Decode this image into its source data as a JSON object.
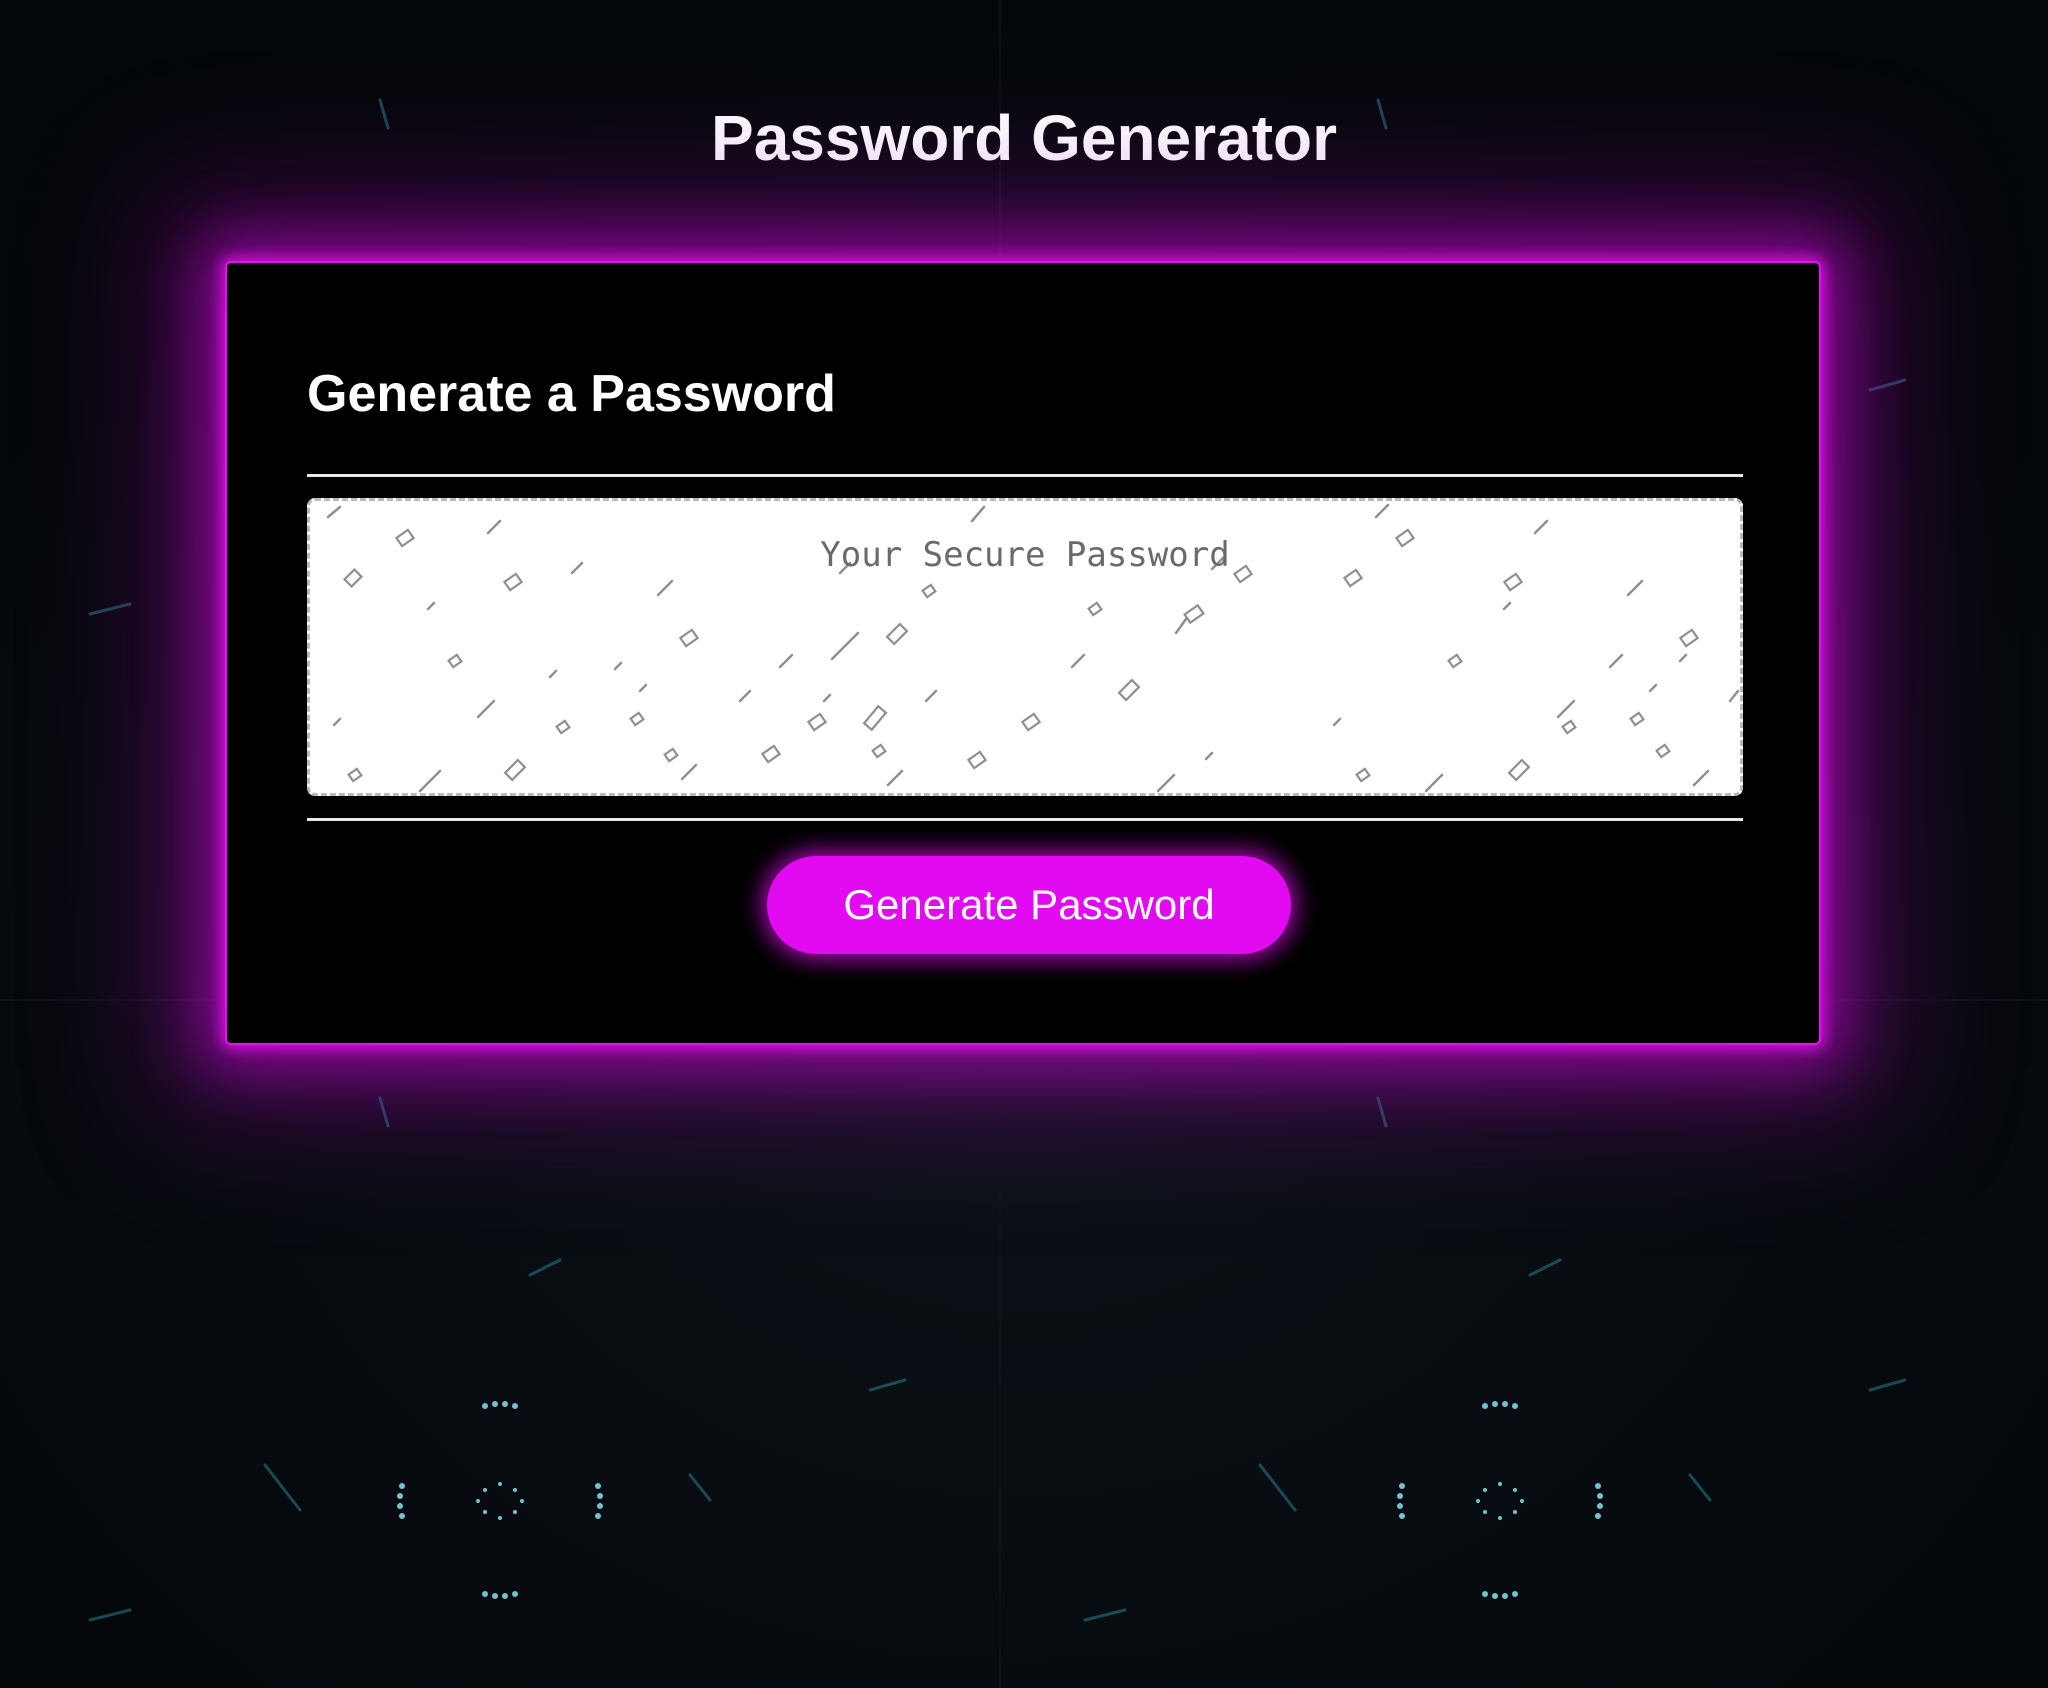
{
  "page": {
    "title": "Password Generator"
  },
  "card": {
    "title": "Generate a Password",
    "password": {
      "value": "",
      "placeholder": "Your Secure Password"
    },
    "generate_button_label": "Generate Password"
  },
  "colors": {
    "accent": "#e10af0",
    "background": "#05080b",
    "card_background": "#000000",
    "text": "#ffffff"
  }
}
